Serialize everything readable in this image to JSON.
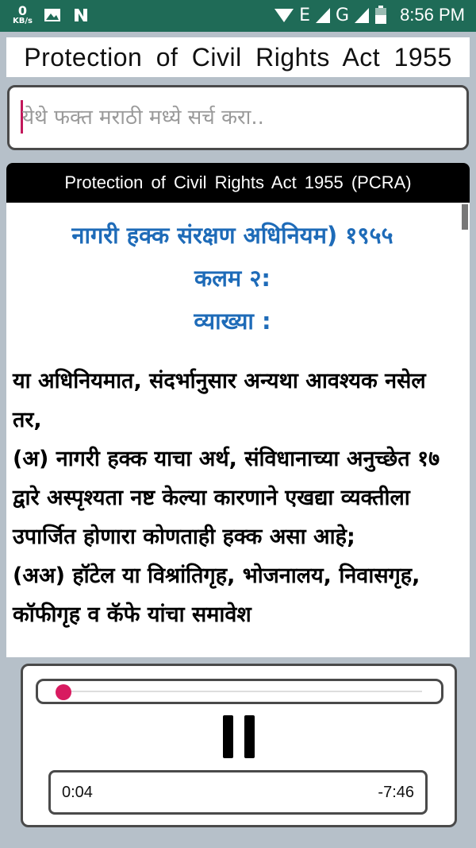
{
  "status_bar": {
    "network_speed_value": "0",
    "network_speed_unit": "KB/s",
    "icons": [
      "image-icon",
      "n-app-icon",
      "wifi-icon",
      "signal-icon",
      "battery-icon"
    ],
    "network_e": "E",
    "network_g": "G",
    "time": "8:56 PM",
    "color": "#1f6b57"
  },
  "app": {
    "title": "Protection of Civil Rights Act 1955"
  },
  "search": {
    "placeholder": "येथे फक्त मराठी मध्ये सर्च करा..",
    "value": ""
  },
  "content": {
    "header": "Protection of Civil Rights Act 1955 (PCRA)",
    "heading_line1": "नागरी हक्क संरक्षण अधिनियम) १९५५",
    "heading_line2": "कलम २:",
    "heading_line3": "व्याख्या :",
    "heading_color": "#1e6bb8",
    "body": "या अधिनियमात, संदर्भानुसार अन्यथा आवश्यक नसेल तर,\n(अ) नागरी हक्क याचा अर्थ, संविधानाच्या अनुच्छेत १७ द्वारे अस्पृश्यता नष्ट केल्या कारणाने एखद्या व्यक्तीला उपार्जित होणारा कोणताही हक्क असा आहे;\n(अअ) हॉटेल या विश्रांतिगृह, भोजनालय, निवासगृह, कॉफीगृह व कॅफे यांचा समावेश"
  },
  "player": {
    "current_time": "0:04",
    "remaining_time": "-7:46",
    "progress": 0.0086,
    "accent_color": "#d81b60"
  }
}
